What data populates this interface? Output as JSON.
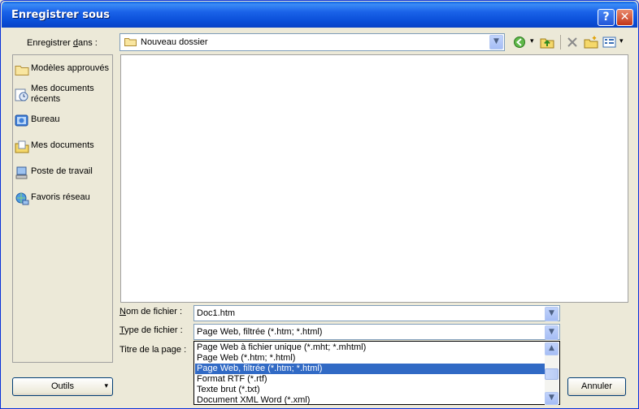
{
  "window": {
    "title": "Enregistrer sous",
    "help_glyph": "?",
    "close_glyph": "✕"
  },
  "lookin": {
    "label_pre": "Enregistrer ",
    "label_u": "d",
    "label_post": "ans :",
    "value": "Nouveau dossier"
  },
  "places": [
    {
      "label": "Modèles approuvés",
      "icon": "folder-icon"
    },
    {
      "label": "Mes documents récents",
      "icon": "recent-documents-icon"
    },
    {
      "label": "Bureau",
      "icon": "desktop-icon"
    },
    {
      "label": "Mes documents",
      "icon": "my-documents-icon"
    },
    {
      "label": "Poste de travail",
      "icon": "my-computer-icon"
    },
    {
      "label": "Favoris réseau",
      "icon": "network-places-icon"
    }
  ],
  "filename": {
    "label_u": "N",
    "label_post": "om de fichier :",
    "value": "Doc1.htm"
  },
  "filetype": {
    "label_u": "T",
    "label_post": "ype de fichier :",
    "value": "Page Web, filtrée (*.htm; *.html)",
    "options": [
      "Page Web à fichier unique (*.mht; *.mhtml)",
      "Page Web (*.htm; *.html)",
      "Page Web, filtrée (*.htm; *.html)",
      "Format RTF (*.rtf)",
      "Texte brut (*.txt)",
      "Document XML Word (*.xml)"
    ],
    "selected_index": 2
  },
  "pagetitle": {
    "label": "Titre de la page :"
  },
  "buttons": {
    "tools": "Outils",
    "tools_arrow": "▾",
    "cancel": "Annuler"
  },
  "glyphs": {
    "down": "▼",
    "up": "▲",
    "tool_dropdown": "▾"
  }
}
